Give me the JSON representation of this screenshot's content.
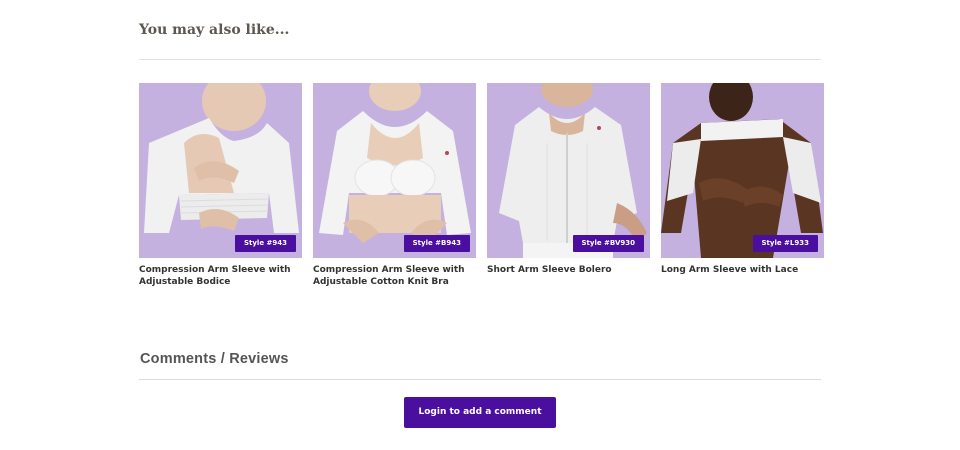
{
  "related": {
    "heading": "You may also like...",
    "products": [
      {
        "title": "Compression Arm Sleeve with Adjustable Bodice",
        "badge": "Style #943",
        "image_alt": "model wearing white compression arm sleeve with bodice"
      },
      {
        "title": "Compression Arm Sleeve with Adjustable Cotton Knit Bra",
        "badge": "Style #B943",
        "image_alt": "model wearing white arm sleeve with knit bra"
      },
      {
        "title": "Short Arm Sleeve Bolero",
        "badge": "Style #BV930",
        "image_alt": "model wearing white short arm sleeve bolero"
      },
      {
        "title": "Long Arm Sleeve with Lace",
        "badge": "Style #L933",
        "image_alt": "model wearing white long arm sleeve with lace"
      }
    ]
  },
  "comments": {
    "heading": "Comments / Reviews",
    "login_label": "Login to add a comment"
  },
  "colors": {
    "accent": "#4b0fa0",
    "image_background": "#c5b1e0"
  }
}
